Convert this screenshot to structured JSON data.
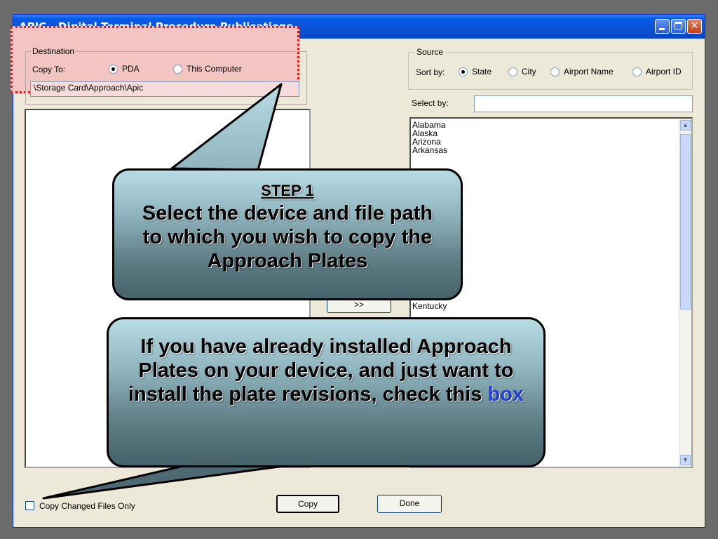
{
  "window": {
    "title": "APIC - Digital Terminal Procedure Publications"
  },
  "destination": {
    "legend": "Destination",
    "copy_to_label": "Copy To:",
    "options": [
      "PDA",
      "This Computer"
    ],
    "selected": "PDA",
    "path_value": "\\Storage Card\\Approach\\Apic"
  },
  "source": {
    "legend": "Source",
    "sort_by_label": "Sort by:",
    "options": [
      "State",
      "City",
      "Airport Name",
      "Airport ID"
    ],
    "selected": "State",
    "select_by_label": "Select by:",
    "select_by_value": ""
  },
  "state_list": {
    "items_top": [
      "Alabama",
      "Alaska",
      "Arizona",
      "Arkansas"
    ],
    "items_bottom": [
      "Kentucky"
    ]
  },
  "transfer_button": ">>",
  "footer": {
    "copy_changed_label": "Copy Changed Files Only",
    "copy_changed_checked": false,
    "copy_button": "Copy",
    "done_button": "Done"
  },
  "callouts": {
    "step1_header": "STEP 1",
    "step1_text": "Select the device and file path to which you wish to copy the Approach Plates",
    "step2_text": "If you have already installed Approach Plates on your device, and just want to install the plate revisions, check this",
    "step2_highlight": "box",
    "highlight_color": "#1e3fd6"
  }
}
